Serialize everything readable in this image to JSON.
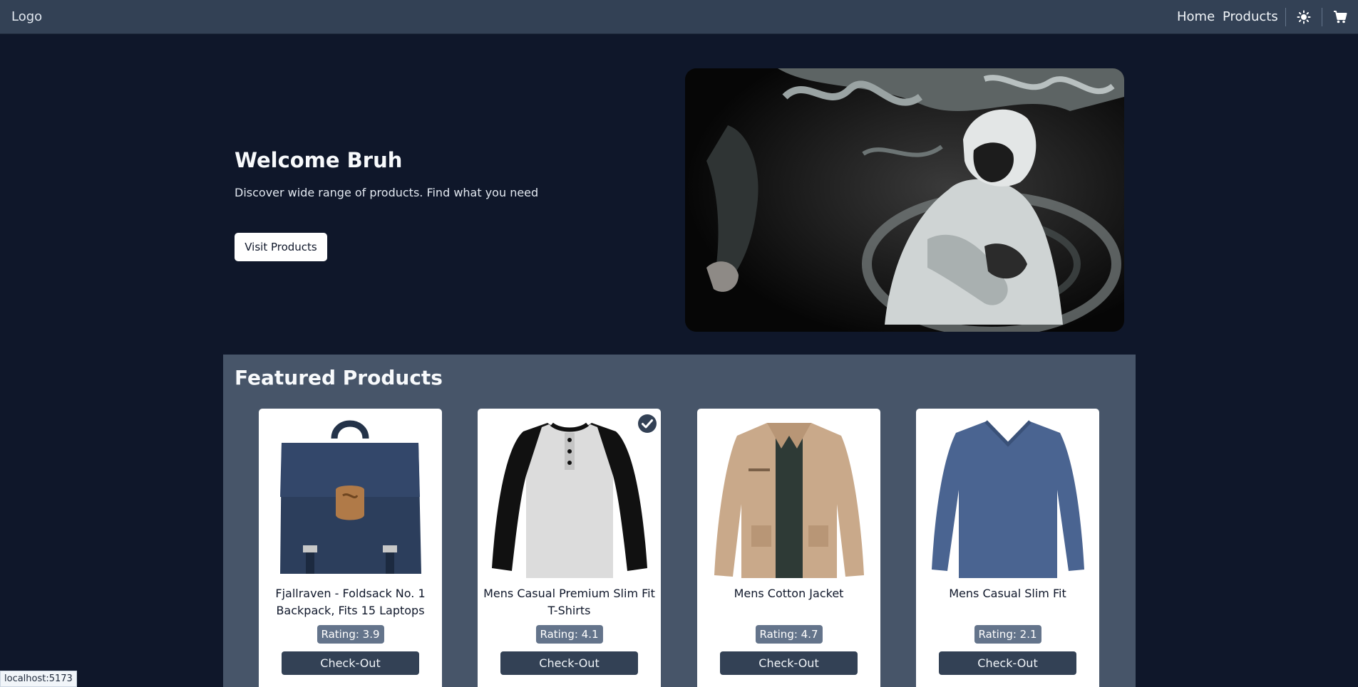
{
  "navbar": {
    "logo": "Logo",
    "links": [
      "Home",
      "Products"
    ],
    "theme_icon": "sun-icon",
    "cart_icon": "cart-icon"
  },
  "hero": {
    "title": "Welcome Bruh",
    "subtitle": "Discover wide range of products. Find what you need",
    "button_label": "Visit Products"
  },
  "featured": {
    "title": "Featured Products",
    "products": [
      {
        "title": "Fjallraven - Foldsack No. 1 Backpack, Fits 15 Laptops",
        "rating": "Rating: 3.9",
        "button": "Check-Out"
      },
      {
        "title": "Mens Casual Premium Slim Fit T-Shirts",
        "rating": "Rating: 4.1",
        "button": "Check-Out"
      },
      {
        "title": "Mens Cotton Jacket",
        "rating": "Rating: 4.7",
        "button": "Check-Out"
      },
      {
        "title": "Mens Casual Slim Fit",
        "rating": "Rating: 2.1",
        "button": "Check-Out"
      }
    ]
  },
  "status_bar": {
    "url": "localhost:5173"
  }
}
